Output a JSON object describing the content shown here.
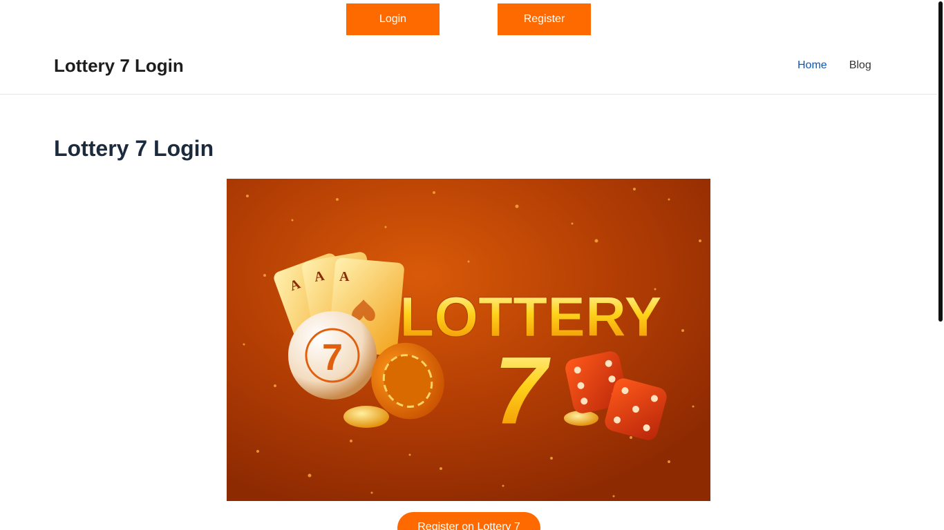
{
  "auth": {
    "login_label": "Login",
    "register_label": "Register",
    "button_color": "#ff6a00"
  },
  "header": {
    "site_title": "Lottery 7 Login",
    "nav": {
      "home": "Home",
      "blog": "Blog"
    },
    "active_nav_color": "#0b57b5"
  },
  "main": {
    "page_title": "Lottery 7 Login",
    "hero": {
      "headline": "LOTTERY",
      "number": "7",
      "ball_number": "7",
      "card_rank": "A",
      "description_icons": [
        "playing-cards-icon",
        "lottery-ball-icon",
        "casino-chip-icon",
        "gold-coin-icon",
        "dice-icon"
      ]
    },
    "cta_label": "Register on Lottery 7"
  }
}
